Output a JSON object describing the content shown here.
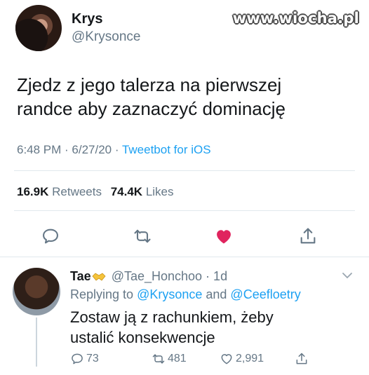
{
  "watermark": "www.wiocha.pl",
  "main_tweet": {
    "name": "Krys",
    "handle": "@Krysonce",
    "text": "Zjedz z jego talerza na pierwszej\nrandce aby zaznaczyć dominację",
    "time_date": "6:48 PM · 6/27/20 · ",
    "source": "Tweetbot for iOS",
    "retweets_count": "16.9K",
    "retweets_label": "Retweets",
    "likes_count": "74.4K",
    "likes_label": "Likes",
    "actions": [
      "reply-icon",
      "retweet-icon",
      "heart-icon",
      "share-icon"
    ],
    "like_color": "#e0245e"
  },
  "reply": {
    "name": "Tae",
    "handle_time": "@Tae_Honchoo · 1d",
    "replying_prefix": "Replying to ",
    "mention1": "@Krysonce",
    "and": " and ",
    "mention2": "@Ceefloetry",
    "text": "Zostaw ją z rachunkiem, żeby\nustalić konsekwencje",
    "replies": "73",
    "retweets": "481",
    "likes": "2,991"
  },
  "colors": {
    "accent": "#1da1f2",
    "muted": "#657786",
    "text": "#14171a"
  }
}
